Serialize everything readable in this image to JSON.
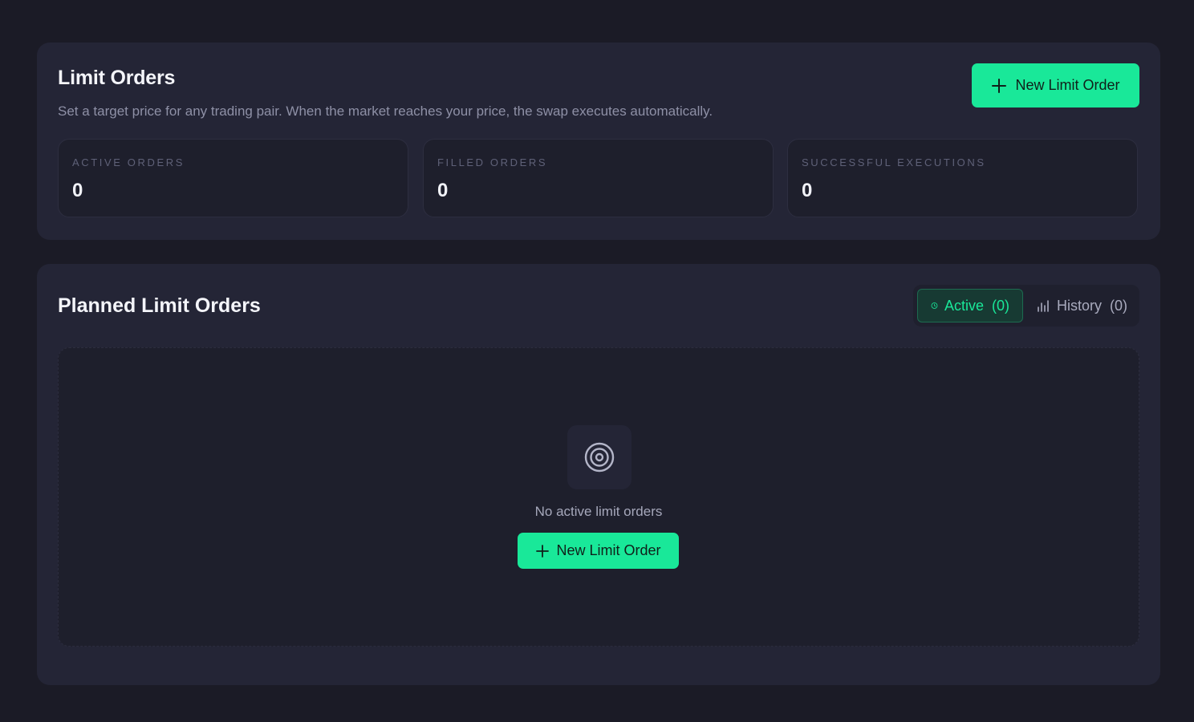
{
  "header": {
    "title": "Limit Orders",
    "subtitle": "Set a target price for any trading pair. When the market reaches your price, the swap executes automatically.",
    "new_order_label": "New Limit Order"
  },
  "stats": [
    {
      "label": "ACTIVE ORDERS",
      "value": "0"
    },
    {
      "label": "FILLED ORDERS",
      "value": "0"
    },
    {
      "label": "SUCCESSFUL EXECUTIONS",
      "value": "0"
    }
  ],
  "planned": {
    "title": "Planned Limit Orders",
    "tabs": [
      {
        "label": "Active",
        "count": "(0)",
        "icon": "clock-icon",
        "active": true
      },
      {
        "label": "History",
        "count": "(0)",
        "icon": "bar-chart-icon",
        "active": false
      }
    ],
    "empty": {
      "icon": "target-icon",
      "message": "No active limit orders",
      "button_label": "New Limit Order"
    }
  },
  "colors": {
    "background": "#1b1b26",
    "card": "#242536",
    "accent": "#19e899"
  }
}
